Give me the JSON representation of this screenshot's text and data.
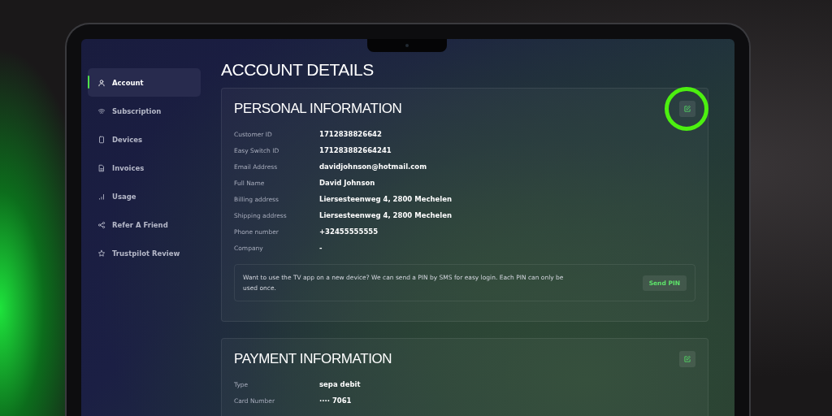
{
  "sidebar": {
    "items": [
      {
        "label": "Account",
        "selected": true
      },
      {
        "label": "Subscription",
        "selected": false
      },
      {
        "label": "Devices",
        "selected": false
      },
      {
        "label": "Invoices",
        "selected": false
      },
      {
        "label": "Usage",
        "selected": false
      },
      {
        "label": "Refer A Friend",
        "selected": false
      },
      {
        "label": "Trustpilot Review",
        "selected": false
      }
    ]
  },
  "page_title": "ACCOUNT DETAILS",
  "cards": [
    {
      "title": "PERSONAL INFORMATION",
      "edit_highlighted": true,
      "rows": [
        {
          "label": "Customer ID",
          "value": "1712838826642"
        },
        {
          "label": "Easy Switch ID",
          "value": "171283882664241"
        },
        {
          "label": "Email Address",
          "value": "davidjohnson@hotmail.com"
        },
        {
          "label": "Full Name",
          "value": "David Johnson"
        },
        {
          "label": "Billing address",
          "value": "Liersesteenweg 4, 2800 Mechelen"
        },
        {
          "label": "Shipping address",
          "value": "Liersesteenweg 4, 2800 Mechelen"
        },
        {
          "label": "Phone number",
          "value": "+32455555555"
        },
        {
          "label": "Company",
          "value": "-"
        }
      ],
      "notice": {
        "text": "Want to use the TV app on a new device? We can send a PIN by SMS for easy login. Each PIN can only be used once.",
        "button": "Send PIN"
      }
    },
    {
      "title": "PAYMENT INFORMATION",
      "edit_highlighted": false,
      "rows": [
        {
          "label": "Type",
          "value": "sepa debit"
        },
        {
          "label": "Card Number",
          "value": "···· 7061"
        }
      ]
    }
  ]
}
